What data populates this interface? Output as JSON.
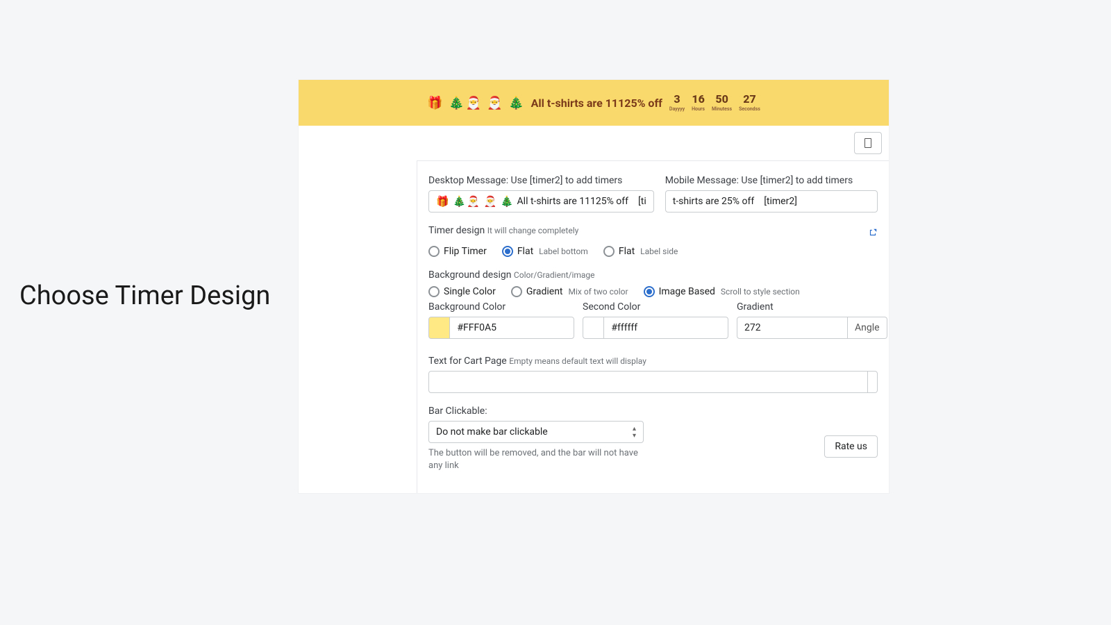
{
  "caption": "Choose Timer Design",
  "preview": {
    "emoji": "🎁 🎄🎅 🎅 🎄",
    "text": "All t-shirts are 11125% off",
    "countdown": [
      {
        "value": "3",
        "label": "Dayyyy"
      },
      {
        "value": "16",
        "label": "Hours"
      },
      {
        "value": "50",
        "label": "Minutess"
      },
      {
        "value": "27",
        "label": "Secondss"
      }
    ]
  },
  "fields": {
    "desktop_label": "Desktop Message: Use [timer2] to add timers",
    "desktop_emoji": "🎁 🎄🎅 🎅 🎄",
    "desktop_value": "All t-shirts are 11125% off",
    "desktop_tag": "[ti",
    "mobile_label": "Mobile Message: Use [timer2] to add timers",
    "mobile_value": "t-shirts are 25% off",
    "mobile_tag": "[timer2]"
  },
  "timer_design": {
    "label": "Timer design",
    "sub": "It will change completely",
    "options": [
      "Flip Timer",
      "Flat",
      "Flat"
    ],
    "option_subs": [
      "",
      "Label bottom",
      "Label side"
    ],
    "selected": 1
  },
  "bg_design": {
    "label": "Background design",
    "sub": "Color/Gradient/image",
    "options": [
      "Single Color",
      "Gradient",
      "Image Based"
    ],
    "option_subs": [
      "",
      "Mix of two color",
      "Scroll to style section"
    ],
    "selected": 2
  },
  "colors": {
    "bg_label": "Background Color",
    "bg_value": "#FFF0A5",
    "second_label": "Second Color",
    "second_value": "#ffffff",
    "gradient_label": "Gradient",
    "gradient_value": "272",
    "angle_label": "Angle"
  },
  "cart": {
    "label": "Text for Cart Page",
    "sub": "Empty means default text will display"
  },
  "clickable": {
    "label": "Bar Clickable:",
    "value": "Do not make bar clickable",
    "help": "The button will be removed, and the bar will not have any link"
  },
  "rate_label": "Rate us"
}
